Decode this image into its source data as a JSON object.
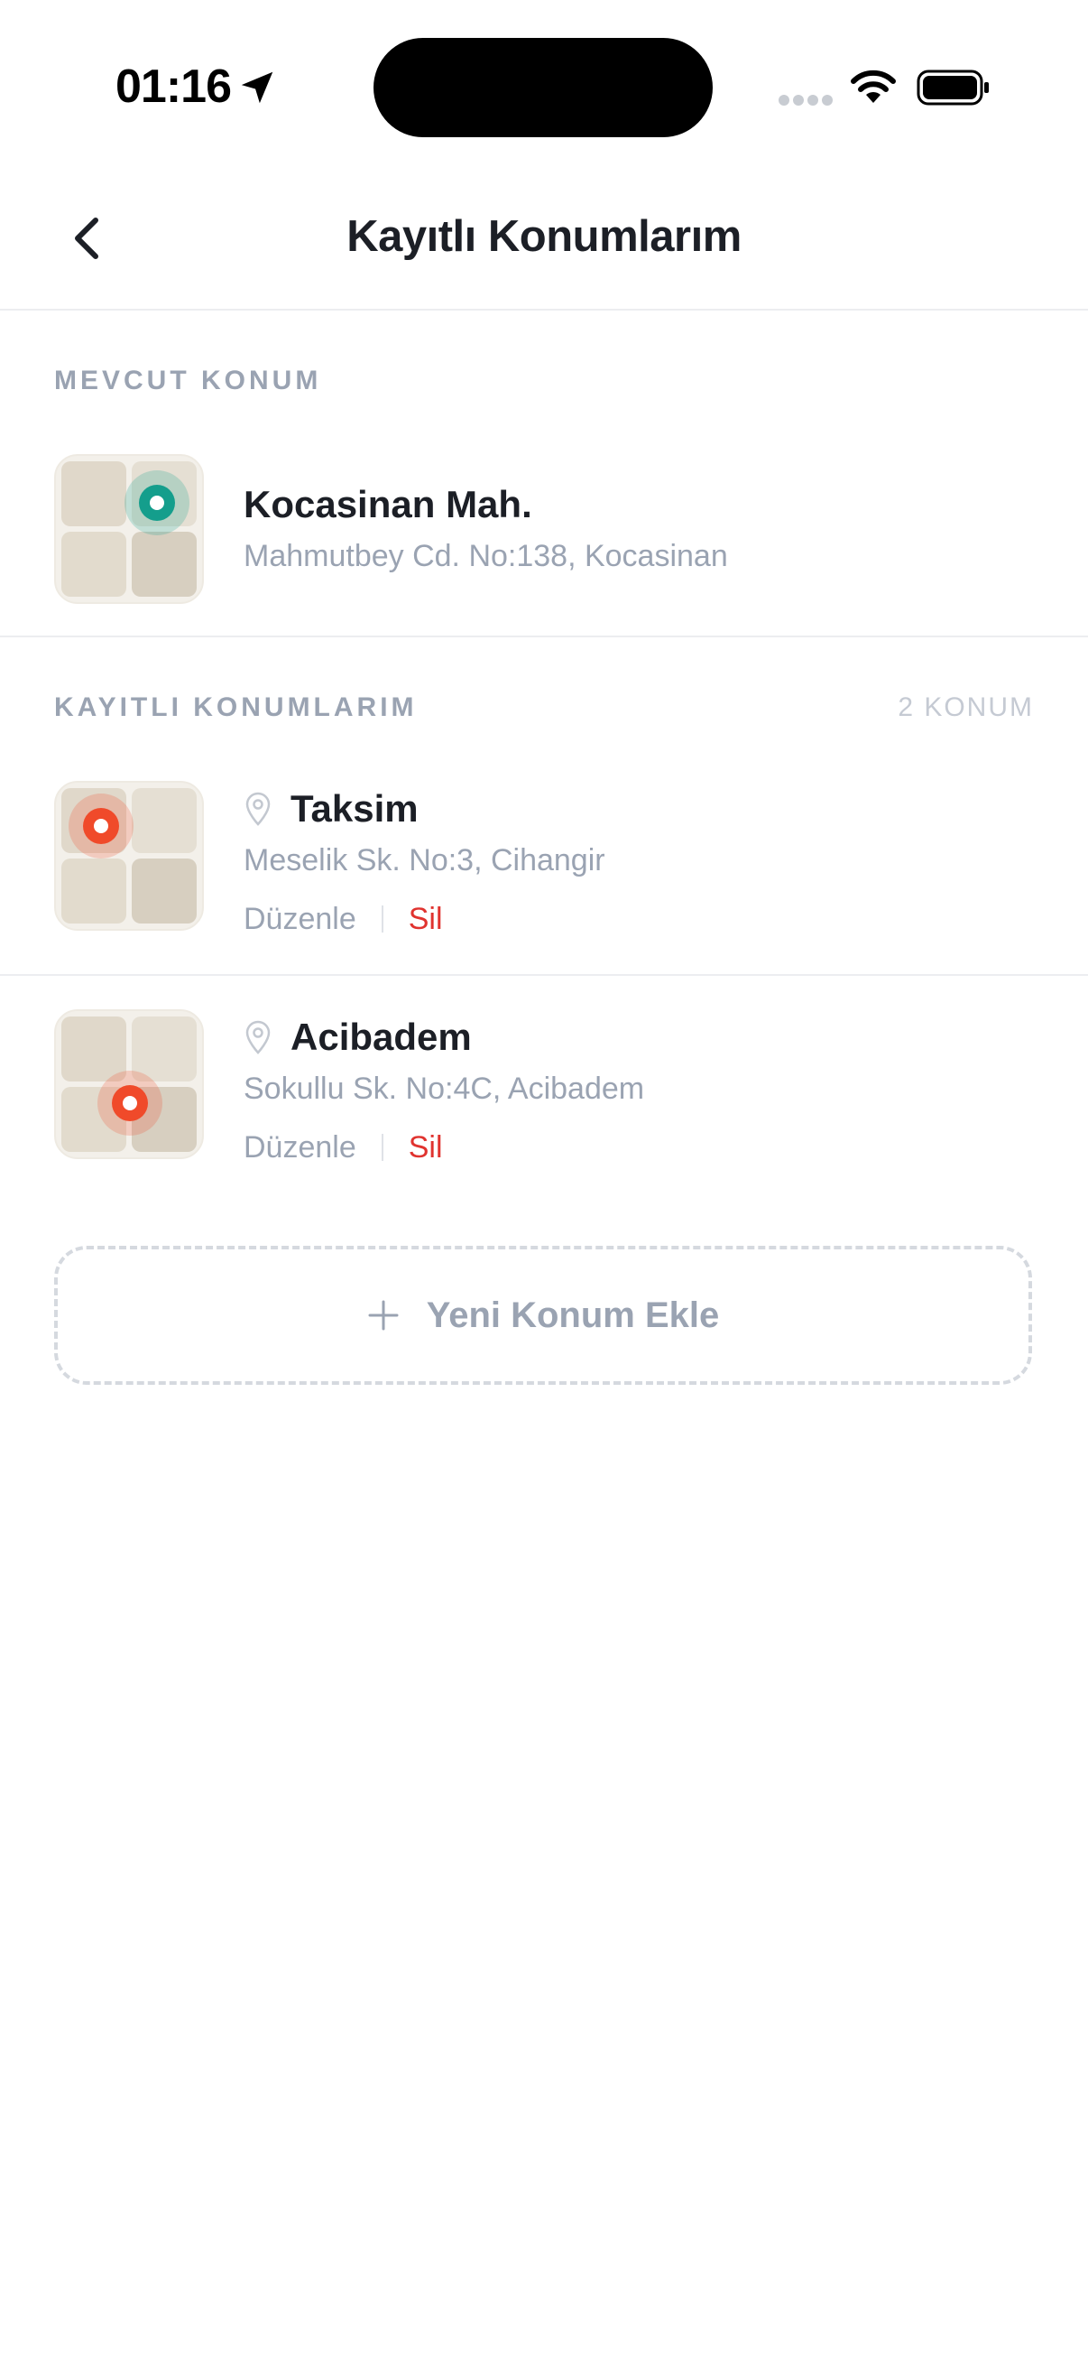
{
  "status_bar": {
    "time": "01:16"
  },
  "nav": {
    "title": "Kayıtlı Konumlarım",
    "back_icon": "chevron-left-icon"
  },
  "current_location": {
    "section_label": "MEVCUT KONUM",
    "title": "Kocasinan Mah.",
    "address": "Mahmutbey Cd. No:138, Kocasinan",
    "pin_color": "#149e8c"
  },
  "saved_locations": {
    "section_label": "KAYITLI KONUMLARIM",
    "count_label": "2 KONUM",
    "items": [
      {
        "title": "Taksim",
        "address": "Meselik Sk. No:3, Cihangir",
        "edit_label": "Düzenle",
        "delete_label": "Sil",
        "pin_color": "#f04a2a"
      },
      {
        "title": "Acibadem",
        "address": "Sokullu Sk. No:4C, Acibadem",
        "edit_label": "Düzenle",
        "delete_label": "Sil",
        "pin_color": "#f04a2a"
      }
    ]
  },
  "add_button": {
    "label": "Yeni Konum Ekle",
    "icon": "plus-icon"
  },
  "colors": {
    "muted_text": "#9aa3b2",
    "delete_red": "#e0332f",
    "current_pin": "#149e8c",
    "saved_pin": "#f04a2a"
  }
}
